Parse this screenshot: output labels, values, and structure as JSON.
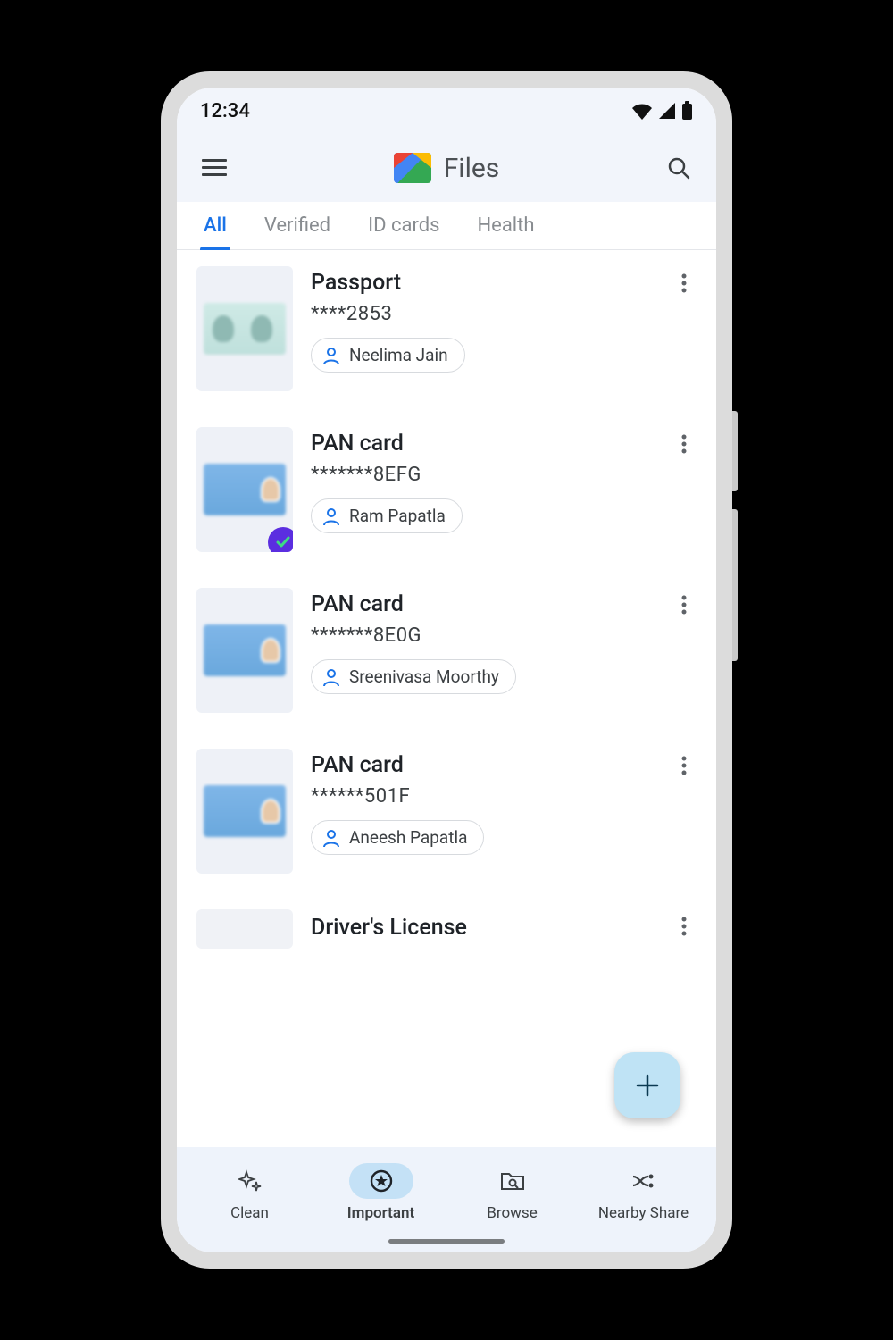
{
  "status": {
    "time": "12:34"
  },
  "header": {
    "title": "Files"
  },
  "tabs": [
    "All",
    "Verified",
    "ID cards",
    "Health"
  ],
  "active_tab": 0,
  "items": [
    {
      "title": "Passport",
      "mask": "****2853",
      "owner": "Neelima Jain",
      "thumb": "passport",
      "verified": false
    },
    {
      "title": "PAN card",
      "mask": "*******8EFG",
      "owner": "Ram Papatla",
      "thumb": "pan",
      "verified": true
    },
    {
      "title": "PAN card",
      "mask": "*******8E0G",
      "owner": "Sreenivasa Moorthy",
      "thumb": "pan",
      "verified": false
    },
    {
      "title": "PAN card",
      "mask": "******501F",
      "owner": "Aneesh Papatla",
      "thumb": "pan",
      "verified": false
    },
    {
      "title": "Driver's License",
      "mask": "",
      "owner": "",
      "thumb": "blank",
      "verified": false
    }
  ],
  "nav": [
    {
      "label": "Clean",
      "icon": "sparkle"
    },
    {
      "label": "Important",
      "icon": "star-circle"
    },
    {
      "label": "Browse",
      "icon": "folder-search"
    },
    {
      "label": "Nearby Share",
      "icon": "shuffle"
    }
  ],
  "active_nav": 1
}
